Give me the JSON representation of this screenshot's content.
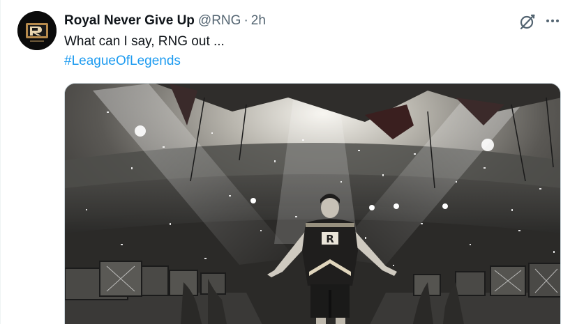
{
  "tweet": {
    "display_name": "Royal Never Give Up",
    "handle": "@RNG",
    "separator": "·",
    "time": "2h",
    "text": "What can I say, RNG out ...",
    "hashtag": "#LeagueOfLegends"
  },
  "icons": {
    "avatar": "rng-logo-avatar",
    "grok": "grok-icon",
    "more": "more-icon"
  },
  "media": {
    "jersey_logo": "R"
  },
  "colors": {
    "text_primary": "#0f1419",
    "text_secondary": "#536471",
    "link": "#1d9bf0",
    "border": "#cfd9de"
  }
}
